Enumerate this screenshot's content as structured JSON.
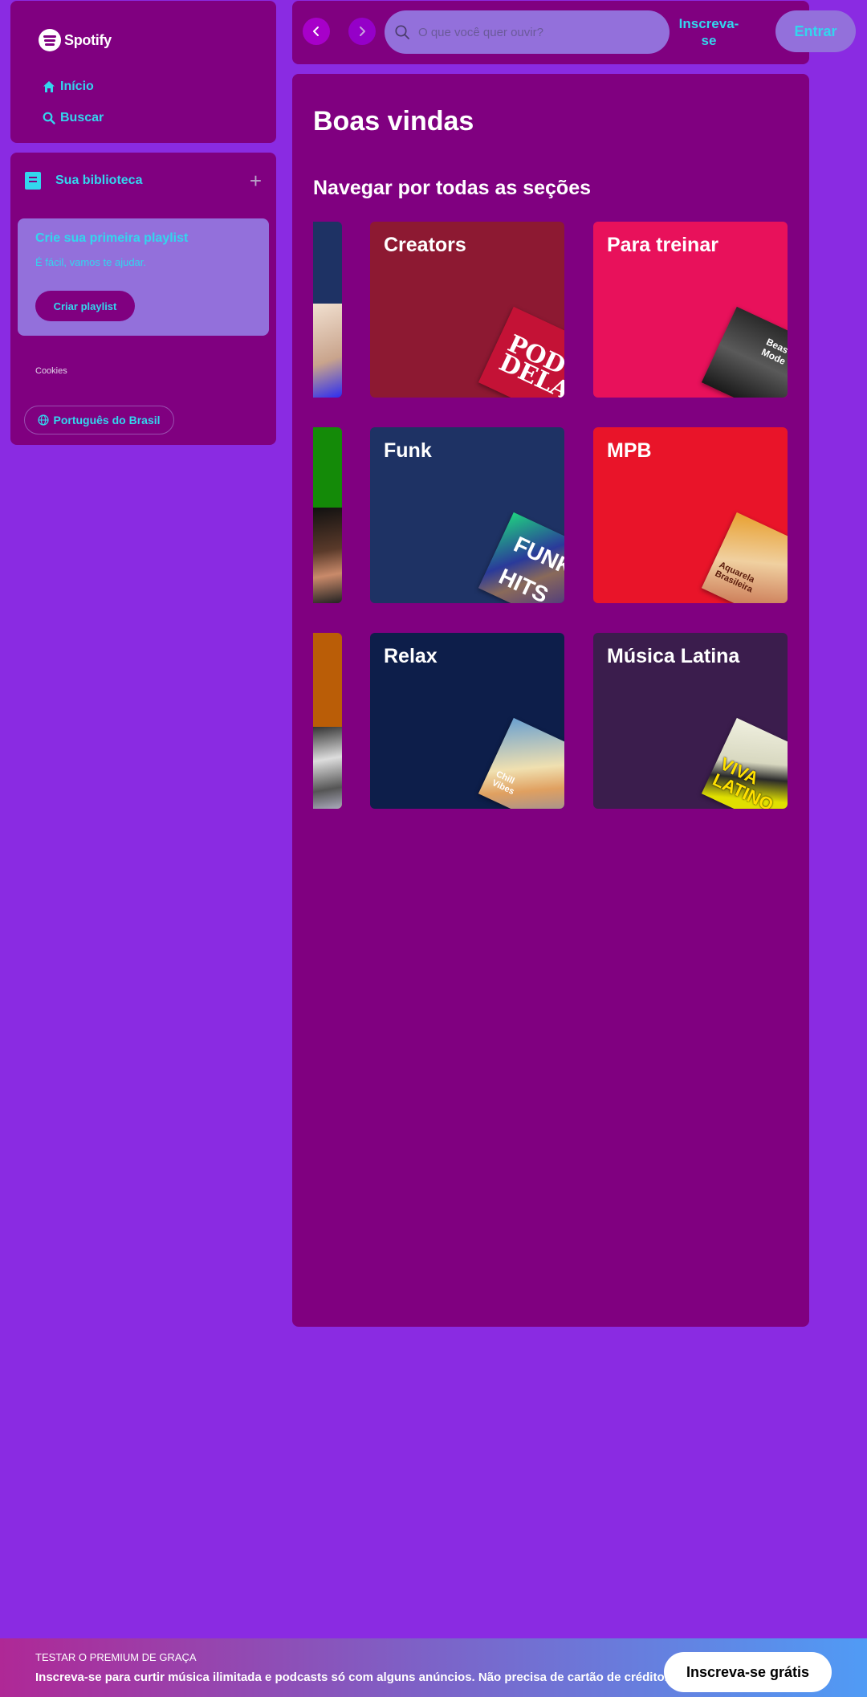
{
  "colors": {
    "background": "#8a2be2",
    "panel": "#800080",
    "accent": "#33d6ee",
    "card_light": "#9370db"
  },
  "sidebar": {
    "logo_text": "Spotify",
    "nav": [
      {
        "label": "Início",
        "icon": "home-icon"
      },
      {
        "label": "Buscar",
        "icon": "search-icon"
      }
    ],
    "library": {
      "title": "Sua biblioteca",
      "icon": "library-icon",
      "add_icon": "plus-icon"
    },
    "create_playlist": {
      "title": "Crie sua primeira playlist",
      "subtitle": "É fácil, vamos te ajudar.",
      "button": "Criar playlist"
    },
    "cookies": "Cookies",
    "language": "Português do Brasil"
  },
  "topbar": {
    "search_placeholder": "O que você quer ouvir?",
    "signup": "Inscreva-se",
    "login": "Entrar"
  },
  "main": {
    "title": "Boas vindas",
    "section": "Navegar por todas as seções",
    "categories": [
      {
        "label": "Creators",
        "color": "#8d1932",
        "art_text": "POD DELAS"
      },
      {
        "label": "Para treinar",
        "color": "#e8115b",
        "art_text": "Beast Mode"
      },
      {
        "label": "Funk",
        "color": "#1e3264",
        "art_text": "FUNK HITS"
      },
      {
        "label": "MPB",
        "color": "#e91429",
        "art_text": "Aquarela Brasileira"
      },
      {
        "label": "Relax",
        "color": "#0d1e4a",
        "art_text": "Chill Vibes"
      },
      {
        "label": "Música Latina",
        "color": "#3b1d4d",
        "art_text": "VIVA LATINO"
      }
    ]
  },
  "banner": {
    "kicker": "TESTAR O PREMIUM DE GRAÇA",
    "text": "Inscreva-se para curtir música ilimitada e podcasts só com alguns anúncios. Não precisa de cartão de crédito.",
    "button": "Inscreva-se grátis"
  }
}
